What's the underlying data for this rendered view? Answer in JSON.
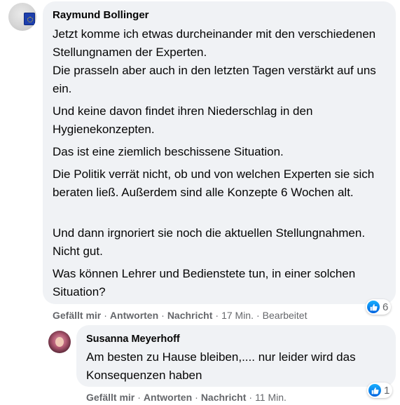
{
  "comments": [
    {
      "author": "Raymund Bollinger",
      "paragraphs": [
        "Jetzt komme ich etwas durcheinander mit den verschiedenen Stellungnamen der Experten.",
        "Die prasseln aber auch in den letzten Tagen verstärkt auf uns ein.",
        "Und keine davon findet ihren Niederschlag in den Hygienekonzepten.",
        "Das ist eine ziemlich beschissene Situation.",
        "Die Politik verrät nicht, ob und von welchen Experten sie sich beraten ließ. Außerdem sind alle Konzepte 6 Wochen alt.",
        "Und dann irgnoriert sie noch die aktuellen Stellungnahmen. Nicht gut.",
        "Was können Lehrer und Bedienstete tun, in einer solchen Situation?"
      ],
      "reaction_count": "6",
      "actions": {
        "like": "Gefällt mir",
        "reply": "Antworten",
        "message": "Nachricht",
        "time": "17 Min.",
        "edited": "Bearbeitet"
      }
    },
    {
      "author": "Susanna Meyerhoff",
      "paragraphs": [
        "Am besten zu Hause bleiben,.... nur leider wird das Konsequenzen haben"
      ],
      "reaction_count": "1",
      "actions": {
        "like": "Gefällt mir",
        "reply": "Antworten",
        "message": "Nachricht",
        "time": "11 Min."
      }
    }
  ],
  "separator": "·",
  "icons": {
    "reaction": "like-thumbs-up-icon"
  },
  "colors": {
    "bubble": "#f0f2f5",
    "like_blue": "#1877f2",
    "meta_text": "#65676b",
    "text": "#050505"
  }
}
